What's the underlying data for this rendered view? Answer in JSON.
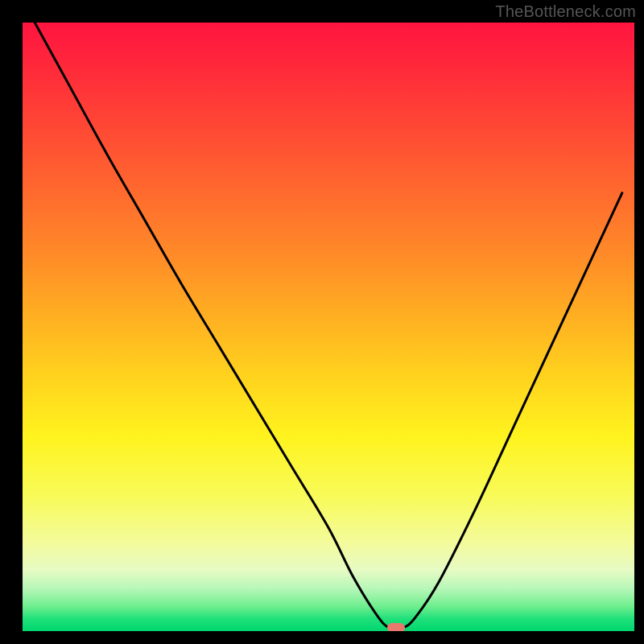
{
  "watermark": "TheBottleneck.com",
  "chart_data": {
    "type": "line",
    "title": "",
    "xlabel": "",
    "ylabel": "",
    "xlim": [
      0,
      100
    ],
    "ylim": [
      0,
      100
    ],
    "grid": false,
    "legend": false,
    "series": [
      {
        "name": "bottleneck-curve",
        "x": [
          2,
          8,
          14,
          20,
          26,
          32,
          38,
          44,
          50,
          54,
          58,
          60,
          62,
          64,
          68,
          74,
          80,
          86,
          92,
          98
        ],
        "values": [
          100,
          89,
          78,
          67.5,
          57,
          47,
          37,
          27,
          17,
          9,
          2.5,
          0.5,
          0.5,
          2,
          8,
          20,
          33,
          46,
          59,
          72
        ]
      }
    ],
    "marker": {
      "name": "optimal-point",
      "x": 61,
      "y": 0.5,
      "color": "#e9786d"
    },
    "colors": {
      "curve": "#000000",
      "background_gradient": [
        "#ff1440",
        "#ffd21e",
        "#f3fba0",
        "#00d66e"
      ],
      "frame": "#000000",
      "marker": "#e9786d"
    }
  }
}
